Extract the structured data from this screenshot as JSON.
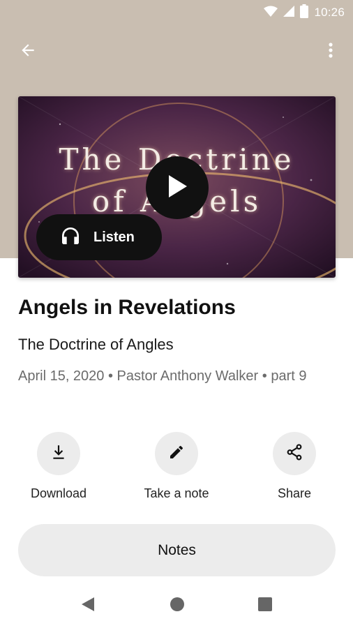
{
  "status_bar": {
    "time": "10:26",
    "icons": [
      "wifi-icon",
      "cellular-signal-icon",
      "battery-icon"
    ]
  },
  "app_bar": {
    "back_icon": "arrow-left-icon",
    "menu_icon": "more-vertical-icon"
  },
  "artwork": {
    "title_line1": "The Doctrine",
    "title_line2": "of Angels",
    "play_icon": "play-icon"
  },
  "listen_button": {
    "label": "Listen",
    "icon": "headphones-icon"
  },
  "sermon": {
    "title": "Angels in Revelations",
    "series": "The Doctrine of Angles",
    "meta": "April 15, 2020 • Pastor Anthony Walker • part 9"
  },
  "actions": [
    {
      "label": "Download",
      "icon": "download-icon"
    },
    {
      "label": "Take a note",
      "icon": "pencil-icon"
    },
    {
      "label": "Share",
      "icon": "share-icon"
    }
  ],
  "notes_button": {
    "label": "Notes"
  },
  "colors": {
    "header_background": "#c9beb1",
    "dark_button": "#111111",
    "light_button": "#ececec",
    "meta_text": "#6b6b6b"
  }
}
